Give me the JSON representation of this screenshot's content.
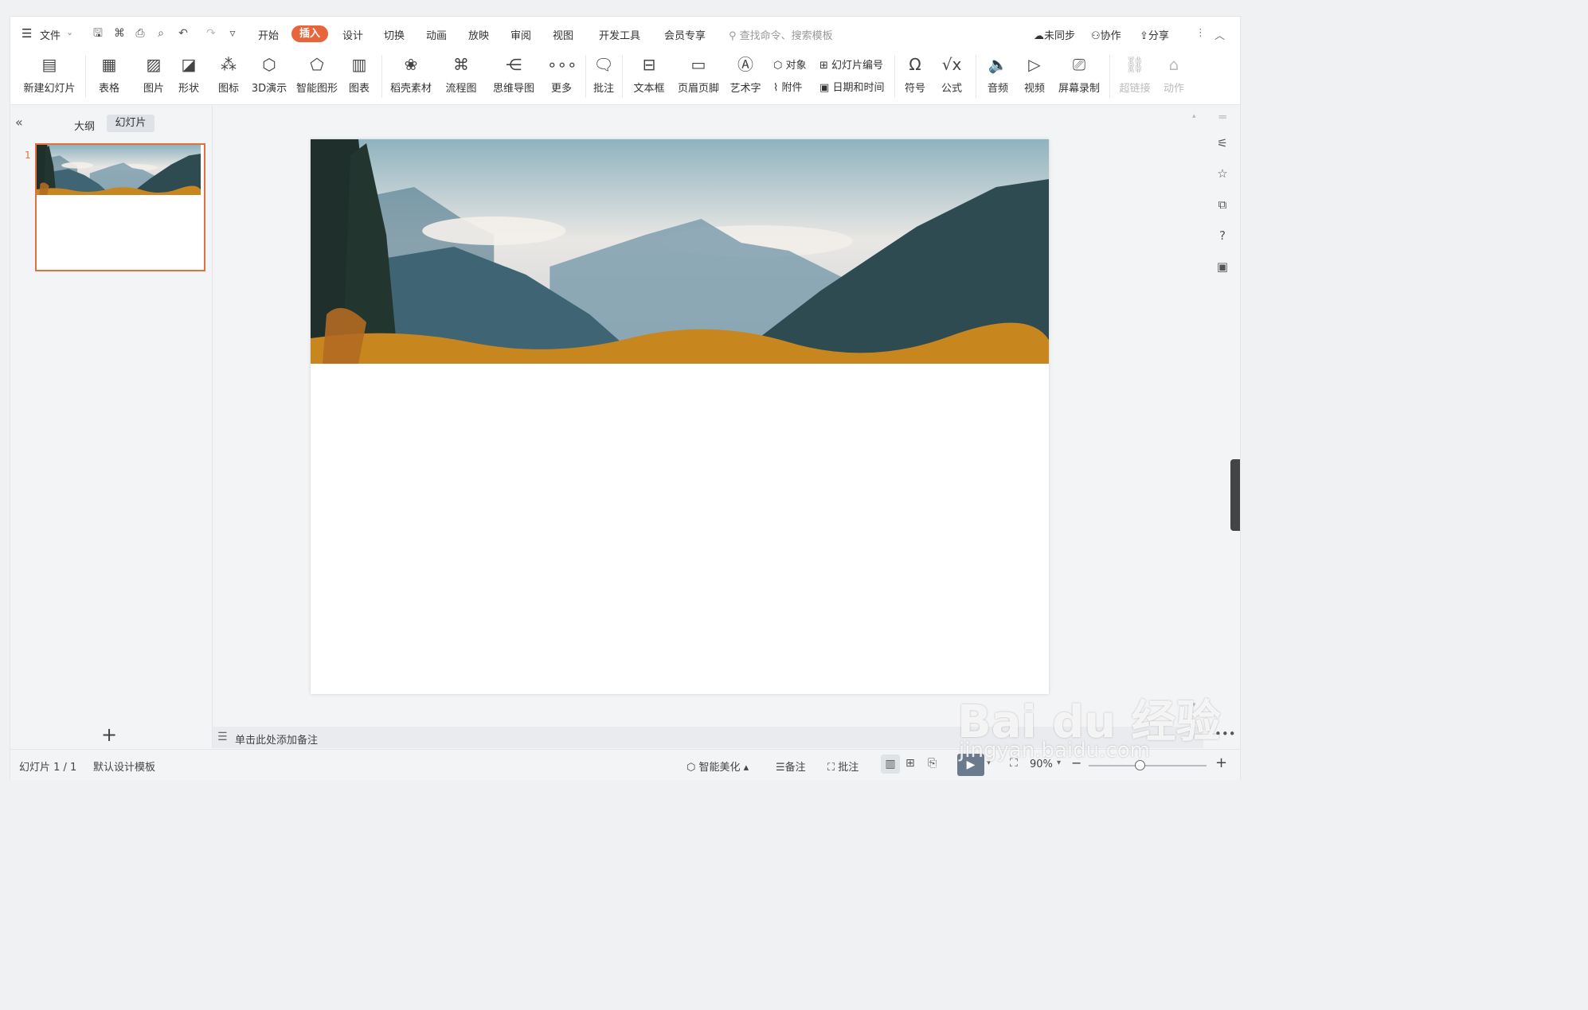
{
  "menubar": {
    "file": "文件",
    "tabs": [
      "开始",
      "插入",
      "设计",
      "切换",
      "动画",
      "放映",
      "审阅",
      "视图",
      "开发工具",
      "会员专享"
    ],
    "active_tab": "插入",
    "search_placeholder": "查找命令、搜索模板",
    "sync": "未同步",
    "collab": "协作",
    "share": "分享"
  },
  "ribbon": {
    "new_slide": "新建幻灯片",
    "table": "表格",
    "picture": "图片",
    "shape": "形状",
    "icon": "图标",
    "demo3d": "3D演示",
    "smartart": "智能图形",
    "chart": "图表",
    "material": "稻壳素材",
    "flowchart": "流程图",
    "mindmap": "思维导图",
    "more": "更多",
    "comment": "批注",
    "textbox": "文本框",
    "header_footer": "页眉页脚",
    "wordart": "艺术字",
    "object": "对象",
    "slide_number": "幻灯片编号",
    "attachment": "附件",
    "datetime": "日期和时间",
    "symbol": "符号",
    "formula": "公式",
    "audio": "音频",
    "video": "视频",
    "screen_record": "屏幕录制",
    "hyperlink": "超链接",
    "action": "动作"
  },
  "leftpanel": {
    "outline_tab": "大纲",
    "slides_tab": "幻灯片",
    "slide_index": "1"
  },
  "notes": {
    "placeholder": "单击此处添加备注"
  },
  "status": {
    "slide_pos": "幻灯片 1 / 1",
    "template": "默认设计模板",
    "beautify": "智能美化",
    "notes": "备注",
    "comment": "批注",
    "zoom": "90%"
  },
  "watermark": {
    "brand": "Bai du 经验",
    "url": "jingyan.baidu.com"
  }
}
